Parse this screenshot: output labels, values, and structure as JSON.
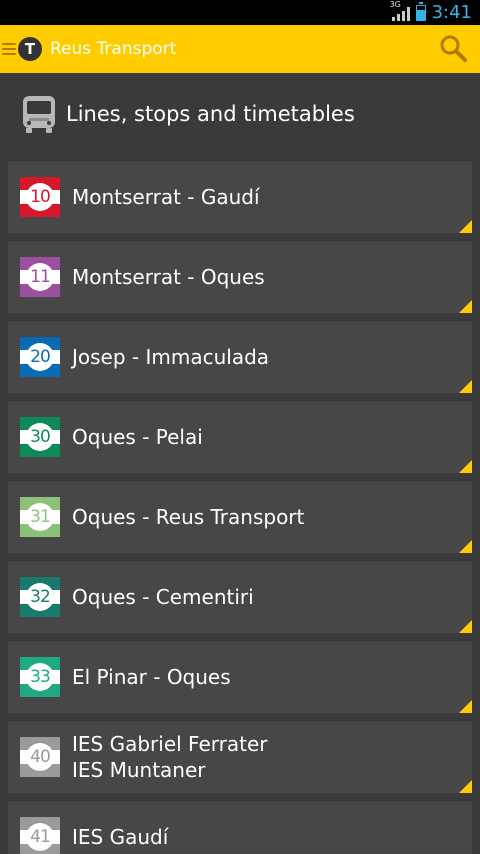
{
  "status_bar": {
    "network": "3G",
    "time": "3:41"
  },
  "app": {
    "title": "Reus Transport",
    "logo_letter": "T"
  },
  "section": {
    "title": "Lines, stops and timetables"
  },
  "lines": [
    {
      "number": "10",
      "name": [
        "Montserrat - Gaudí"
      ],
      "color": "#d7182a"
    },
    {
      "number": "11",
      "name": [
        "Montserrat - Oques"
      ],
      "color": "#9c4f9c"
    },
    {
      "number": "20",
      "name": [
        "Josep - Immaculada"
      ],
      "color": "#0a6bb5"
    },
    {
      "number": "30",
      "name": [
        "Oques - Pelai"
      ],
      "color": "#0e8a58"
    },
    {
      "number": "31",
      "name": [
        "Oques - Reus Transport"
      ],
      "color": "#8dc07a"
    },
    {
      "number": "32",
      "name": [
        "Oques - Cementiri"
      ],
      "color": "#187a6c"
    },
    {
      "number": "33",
      "name": [
        "El Pinar - Oques"
      ],
      "color": "#1ea983"
    },
    {
      "number": "40",
      "name": [
        "IES Gabriel Ferrater",
        "IES Muntaner"
      ],
      "color": "#9a9a9a"
    },
    {
      "number": "41",
      "name": [
        "IES Gaudí"
      ],
      "color": "#9a9a9a"
    }
  ],
  "colors": {
    "accent": "#ffcc00",
    "background": "#3a3a3a",
    "item_bg": "#474747"
  }
}
